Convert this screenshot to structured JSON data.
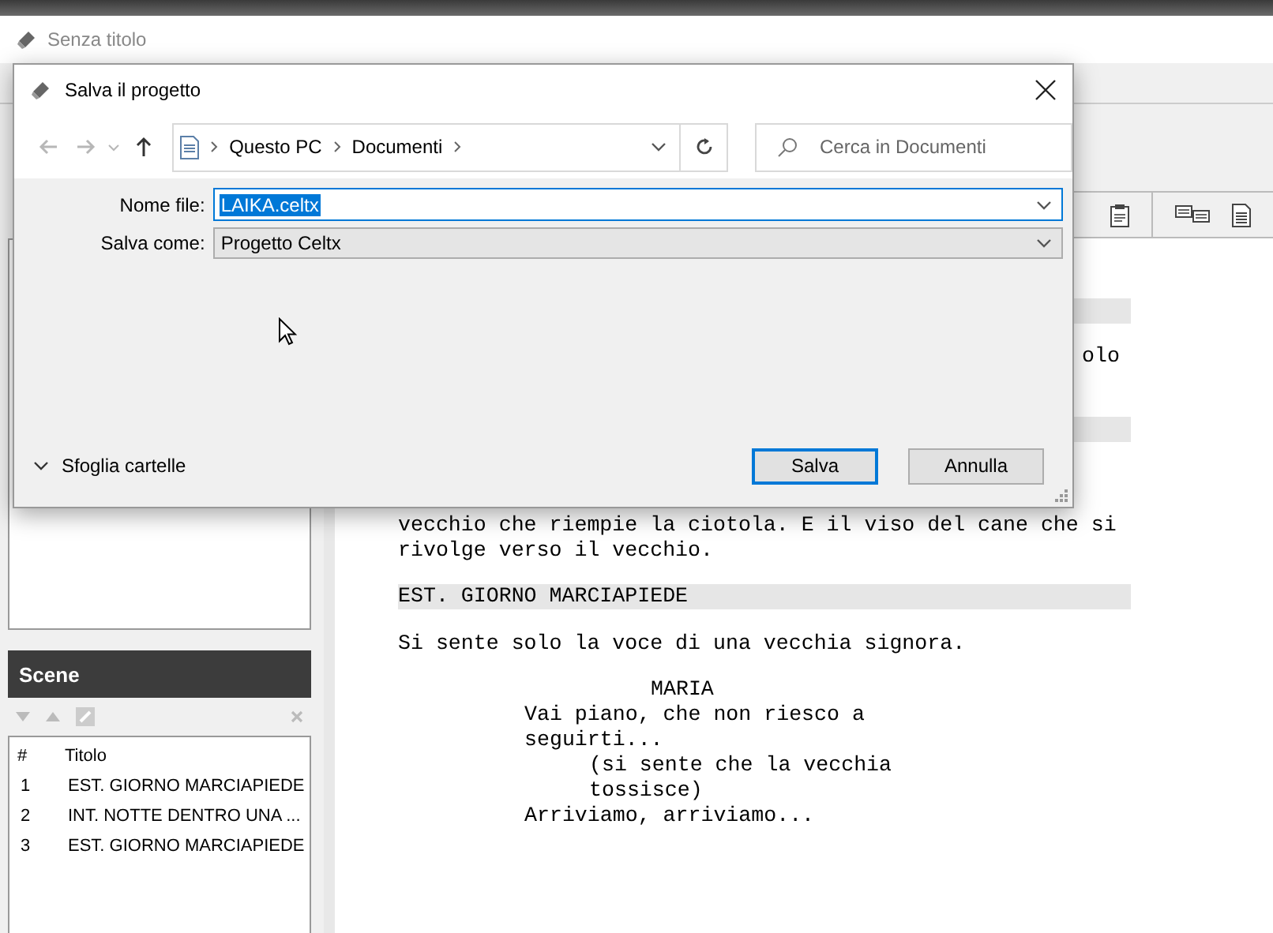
{
  "window": {
    "title": "Senza titolo"
  },
  "scenes_panel": {
    "title": "Scene",
    "columns": [
      "#",
      "Titolo"
    ],
    "rows": [
      {
        "number": "1",
        "title": "EST. GIORNO MARCIAPIEDE"
      },
      {
        "number": "2",
        "title": "INT. NOTTE DENTRO UNA ..."
      },
      {
        "number": "3",
        "title": "EST. GIORNO MARCIAPIEDE"
      }
    ]
  },
  "script": [
    {
      "kind": "heading_bar"
    },
    {
      "kind": "cut_action",
      "text": "olo"
    },
    {
      "kind": "heading_bar"
    },
    {
      "kind": "action",
      "text": "vecchio che riempie la ciotola. E il viso del cane che si"
    },
    {
      "kind": "action_cont",
      "text": "rivolge verso il vecchio."
    },
    {
      "kind": "heading",
      "text": "EST. GIORNO MARCIAPIEDE"
    },
    {
      "kind": "action",
      "text": "Si sente solo la voce di una vecchia signora."
    },
    {
      "kind": "character",
      "text": "MARIA"
    },
    {
      "kind": "dialogue",
      "text": "Vai piano, che non riesco a"
    },
    {
      "kind": "dialogue",
      "text": "seguirti..."
    },
    {
      "kind": "parenthetical",
      "text": "(si sente che la vecchia"
    },
    {
      "kind": "parenthetical",
      "text": "tossisce)"
    },
    {
      "kind": "dialogue",
      "text": "Arriviamo, arriviamo..."
    }
  ],
  "dialog": {
    "title": "Salva il progetto",
    "nav": [
      {
        "kind": "back",
        "disabled": true
      },
      {
        "kind": "forward",
        "disabled": true
      },
      {
        "kind": "recent",
        "disabled": true
      },
      {
        "kind": "up",
        "disabled": false
      }
    ],
    "path": [
      "Questo PC",
      "Documenti"
    ],
    "search": {
      "placeholder": "Cerca in Documenti"
    },
    "fields": [
      {
        "kind": "text",
        "label": "Nome file:",
        "value": "LAIKA.celtx",
        "text_selected": true
      },
      {
        "kind": "select",
        "label": "Salva come:",
        "value": "Progetto Celtx"
      }
    ],
    "browse_folders": {
      "label": "Sfoglia cartelle",
      "expanded": false
    },
    "buttons": [
      {
        "label": "Salva",
        "default": true
      },
      {
        "label": "Annulla",
        "default": false
      }
    ]
  }
}
